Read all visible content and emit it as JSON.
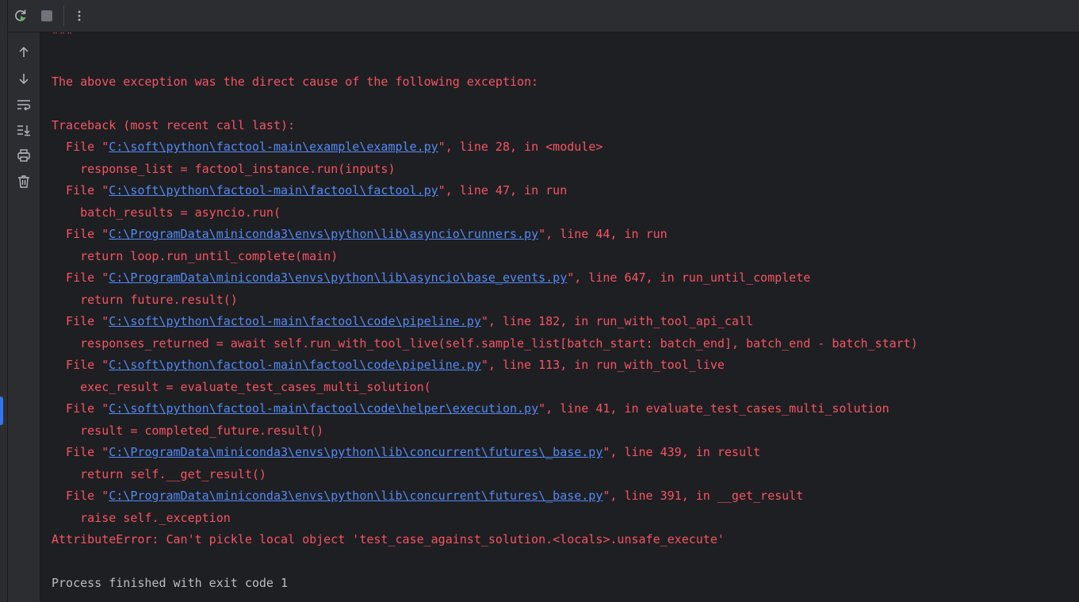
{
  "toolbar": {
    "rerun_icon": "rerun-icon",
    "stop_icon": "stop-icon",
    "more_icon": "more-vertical-icon"
  },
  "sidebar": {
    "icons": [
      "arrow-up-icon",
      "arrow-down-icon",
      "soft-wrap-icon",
      "scroll-to-end-icon",
      "print-icon",
      "trash-icon"
    ]
  },
  "colors": {
    "error": "#f75464",
    "link": "#548af7",
    "normal": "#bcbec4",
    "background": "#1e1f22",
    "panel": "#2b2d30"
  },
  "console": {
    "l0": "\"\"\"",
    "l1": "The above exception was the direct cause of the following exception:",
    "l2": "Traceback (most recent call last):",
    "l3": {
      "pre": "  File \"",
      "link": "C:\\soft\\python\\factool-main\\example\\example.py",
      "post": "\", line 28, in <module>"
    },
    "l4": "    response_list = factool_instance.run(inputs)",
    "l5": {
      "pre": "  File \"",
      "link": "C:\\soft\\python\\factool-main\\factool\\factool.py",
      "post": "\", line 47, in run"
    },
    "l6": "    batch_results = asyncio.run(",
    "l7": {
      "pre": "  File \"",
      "link": "C:\\ProgramData\\miniconda3\\envs\\python\\lib\\asyncio\\runners.py",
      "post": "\", line 44, in run"
    },
    "l8": "    return loop.run_until_complete(main)",
    "l9": {
      "pre": "  File \"",
      "link": "C:\\ProgramData\\miniconda3\\envs\\python\\lib\\asyncio\\base_events.py",
      "post": "\", line 647, in run_until_complete"
    },
    "l10": "    return future.result()",
    "l11": {
      "pre": "  File \"",
      "link": "C:\\soft\\python\\factool-main\\factool\\code\\pipeline.py",
      "post": "\", line 182, in run_with_tool_api_call"
    },
    "l12": "    responses_returned = await self.run_with_tool_live(self.sample_list[batch_start: batch_end], batch_end - batch_start)",
    "l13": {
      "pre": "  File \"",
      "link": "C:\\soft\\python\\factool-main\\factool\\code\\pipeline.py",
      "post": "\", line 113, in run_with_tool_live"
    },
    "l14": "    exec_result = evaluate_test_cases_multi_solution(",
    "l15": {
      "pre": "  File \"",
      "link": "C:\\soft\\python\\factool-main\\factool\\code\\helper\\execution.py",
      "post": "\", line 41, in evaluate_test_cases_multi_solution"
    },
    "l16": "    result = completed_future.result()",
    "l17": {
      "pre": "  File \"",
      "link": "C:\\ProgramData\\miniconda3\\envs\\python\\lib\\concurrent\\futures\\_base.py",
      "post": "\", line 439, in result"
    },
    "l18": "    return self.__get_result()",
    "l19": {
      "pre": "  File \"",
      "link": "C:\\ProgramData\\miniconda3\\envs\\python\\lib\\concurrent\\futures\\_base.py",
      "post": "\", line 391, in __get_result"
    },
    "l20": "    raise self._exception",
    "l21": "AttributeError: Can't pickle local object 'test_case_against_solution.<locals>.unsafe_execute'",
    "l22": "Process finished with exit code 1"
  }
}
